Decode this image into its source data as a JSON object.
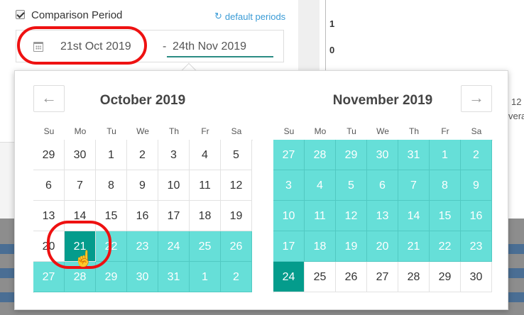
{
  "comparison": {
    "checkbox_checked": true,
    "label": "Comparison Period",
    "default_periods_label": "default periods",
    "start_date": "21st Oct 2019",
    "separator": "-",
    "end_date": "24th Nov 2019"
  },
  "background_chart": {
    "y_tick_1": "1",
    "y_tick_0": "0",
    "x_tick": "12",
    "x_partial": "vera"
  },
  "weekdays": [
    "Su",
    "Mo",
    "Tu",
    "We",
    "Th",
    "Fr",
    "Sa"
  ],
  "months": [
    {
      "title": "October 2019",
      "weeks": [
        [
          "29",
          "30",
          "1",
          "2",
          "3",
          "4",
          "5"
        ],
        [
          "6",
          "7",
          "8",
          "9",
          "10",
          "11",
          "12"
        ],
        [
          "13",
          "14",
          "15",
          "16",
          "17",
          "18",
          "19"
        ],
        [
          "20",
          "21",
          "22",
          "23",
          "24",
          "25",
          "26"
        ],
        [
          "27",
          "28",
          "29",
          "30",
          "31",
          "1",
          "2"
        ]
      ]
    },
    {
      "title": "November 2019",
      "weeks": [
        [
          "27",
          "28",
          "29",
          "30",
          "31",
          "1",
          "2"
        ],
        [
          "3",
          "4",
          "5",
          "6",
          "7",
          "8",
          "9"
        ],
        [
          "10",
          "11",
          "12",
          "13",
          "14",
          "15",
          "16"
        ],
        [
          "17",
          "18",
          "19",
          "20",
          "21",
          "22",
          "23"
        ],
        [
          "24",
          "25",
          "26",
          "27",
          "28",
          "29",
          "30"
        ]
      ]
    }
  ],
  "nav": {
    "prev": "←",
    "next": "→"
  },
  "colors": {
    "range": "#66dfd8",
    "selected": "#049c8c",
    "annotation": "#ee1111",
    "link": "#3a9bd6"
  }
}
